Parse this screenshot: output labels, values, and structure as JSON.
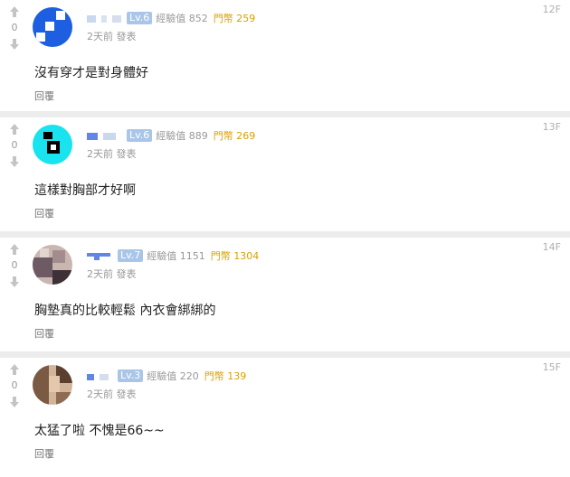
{
  "comments": [
    {
      "floor": "12F",
      "votes": "0",
      "level": "Lv.6",
      "exp": "經驗值 852",
      "coins": "門幣 259",
      "time": "2天前 發表",
      "text": "沒有穿才是對身體好",
      "reply": "回覆",
      "avatar_colors": [
        "#1d5fe0",
        "#ffffff"
      ]
    },
    {
      "floor": "13F",
      "votes": "0",
      "level": "Lv.6",
      "exp": "經驗值 889",
      "coins": "門幣 269",
      "time": "2天前 發表",
      "text": "這樣對胸部才好啊",
      "reply": "回覆",
      "avatar_colors": [
        "#18e3ef",
        "#000000"
      ]
    },
    {
      "floor": "14F",
      "votes": "0",
      "level": "Lv.7",
      "exp": "經驗值 1151",
      "coins": "門幣 1304",
      "time": "2天前 發表",
      "text": "胸墊真的比較輕鬆 內衣會綁綁的",
      "reply": "回覆",
      "avatar_colors": [
        "#6d5a63",
        "#c9b6b1"
      ]
    },
    {
      "floor": "15F",
      "votes": "0",
      "level": "Lv.3",
      "exp": "經驗值 220",
      "coins": "門幣 139",
      "time": "2天前 發表",
      "text": "太猛了啦 不愧是66~~",
      "reply": "回覆",
      "avatar_colors": [
        "#7a5a42",
        "#d2b49a"
      ]
    }
  ],
  "icons": {
    "up": "arrow-up-icon",
    "down": "arrow-down-icon"
  }
}
